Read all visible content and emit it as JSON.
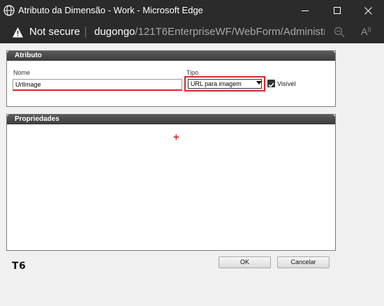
{
  "window": {
    "title": "Atributo da Dimensão - Work - Microsoft Edge",
    "icon": "globe-icon"
  },
  "addressbar": {
    "security_label": "Not secure",
    "url_host": "dugongo",
    "url_path": "/121T6EnterpriseWF/WebForm/Administr..."
  },
  "atributo_panel": {
    "header": "Atributo",
    "nome_label": "Nome",
    "nome_value": "UrlImage",
    "tipo_label": "Tipo",
    "tipo_value": "URL para imagem",
    "visivel_label": "Visível",
    "visivel_checked": true
  },
  "propriedades_panel": {
    "header": "Propriedades",
    "add_symbol": "+"
  },
  "footer": {
    "logo": "T6",
    "ok_label": "OK",
    "cancel_label": "Cancelar"
  },
  "colors": {
    "accent_red": "#d9262c",
    "titlebar": "#2b2b2b"
  }
}
